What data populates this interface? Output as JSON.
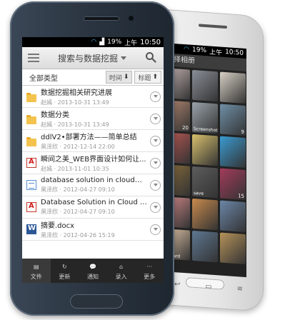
{
  "back_phone": {
    "status": {
      "battery": "19%",
      "ampm": "上午",
      "time": "10:50"
    },
    "title": "选择相册",
    "albums": [
      {
        "count": "",
        "name": "",
        "color": "#c9b7b6"
      },
      {
        "count": "",
        "name": "",
        "color": "#8a8f98"
      },
      {
        "count": "",
        "name": "",
        "color": "#d7d0c5"
      },
      {
        "count": "20",
        "name": "",
        "color": "#b78a73"
      },
      {
        "count": "",
        "name": "Screenshots",
        "color": "#9aa3ab"
      },
      {
        "count": "9",
        "name": "",
        "color": "#6f8fa7"
      },
      {
        "count": "",
        "name": "",
        "color": "#c25a55"
      },
      {
        "count": "",
        "name": "",
        "color": "#d9c16d"
      },
      {
        "count": "",
        "name": "",
        "color": "#3a9bd2"
      },
      {
        "count": "",
        "name": "",
        "color": "#8a6d3b"
      },
      {
        "count": "",
        "name": "save",
        "color": "#5d5d5d"
      },
      {
        "count": "15",
        "name": "",
        "color": "#a33b5c"
      },
      {
        "count": "",
        "name": "",
        "color": "#d78b8b"
      },
      {
        "count": "",
        "name": "",
        "color": "#c98a4d"
      },
      {
        "count": "",
        "name": "",
        "color": "#6b86a8"
      },
      {
        "count": "",
        "name": "sdcard",
        "color": "#e3c7a9"
      },
      {
        "count": "",
        "name": "",
        "color": "#5e7892"
      },
      {
        "count": "",
        "name": "",
        "color": "#b5925a"
      }
    ],
    "nav": {
      "back": "↩",
      "home": "▭",
      "menu": "≡"
    }
  },
  "front_phone": {
    "status": {
      "battery": "19%",
      "ampm": "上午",
      "time": "10:50"
    },
    "actionbar": {
      "title": "搜索与数据挖掘"
    },
    "sortbar": {
      "all_label": "全部类型",
      "time_label": "时间",
      "title_label": "标题"
    },
    "files": [
      {
        "type": "folder",
        "name": "数据挖掘相关研究进展",
        "author": "赵嫣",
        "date": "2013-10-31 13:49"
      },
      {
        "type": "folder",
        "name": "数据分类",
        "author": "赵嫣",
        "date": "2013-10-31 13:49"
      },
      {
        "type": "folder",
        "name": "ddlV2•部署方法——简单总结",
        "author": "黑泽欣",
        "date": "2012-12-14 22:00"
      },
      {
        "type": "pdf",
        "name": "瞬间之美_WEB界面设计如何让...",
        "author": "赵嫣",
        "date": "2013-11-01 10:35"
      },
      {
        "type": "txt",
        "name": "database solution in cloud——...",
        "author": "黑泽欣",
        "date": "2012-04-27 09:10"
      },
      {
        "type": "pdf",
        "name": "Database Solution in Cloud Co...",
        "author": "黑泽欣",
        "date": "2012-04-27 09:10"
      },
      {
        "type": "doc",
        "name": "摘要.docx",
        "author": "黑泽欣",
        "date": "2012-04-26 15:19"
      }
    ],
    "tabs": [
      {
        "label": "文件",
        "icon": "file-icon"
      },
      {
        "label": "更新",
        "icon": "update-icon"
      },
      {
        "label": "通知",
        "icon": "notification-icon"
      },
      {
        "label": "录入",
        "icon": "capture-icon"
      },
      {
        "label": "更多",
        "icon": "more-icon"
      }
    ]
  }
}
